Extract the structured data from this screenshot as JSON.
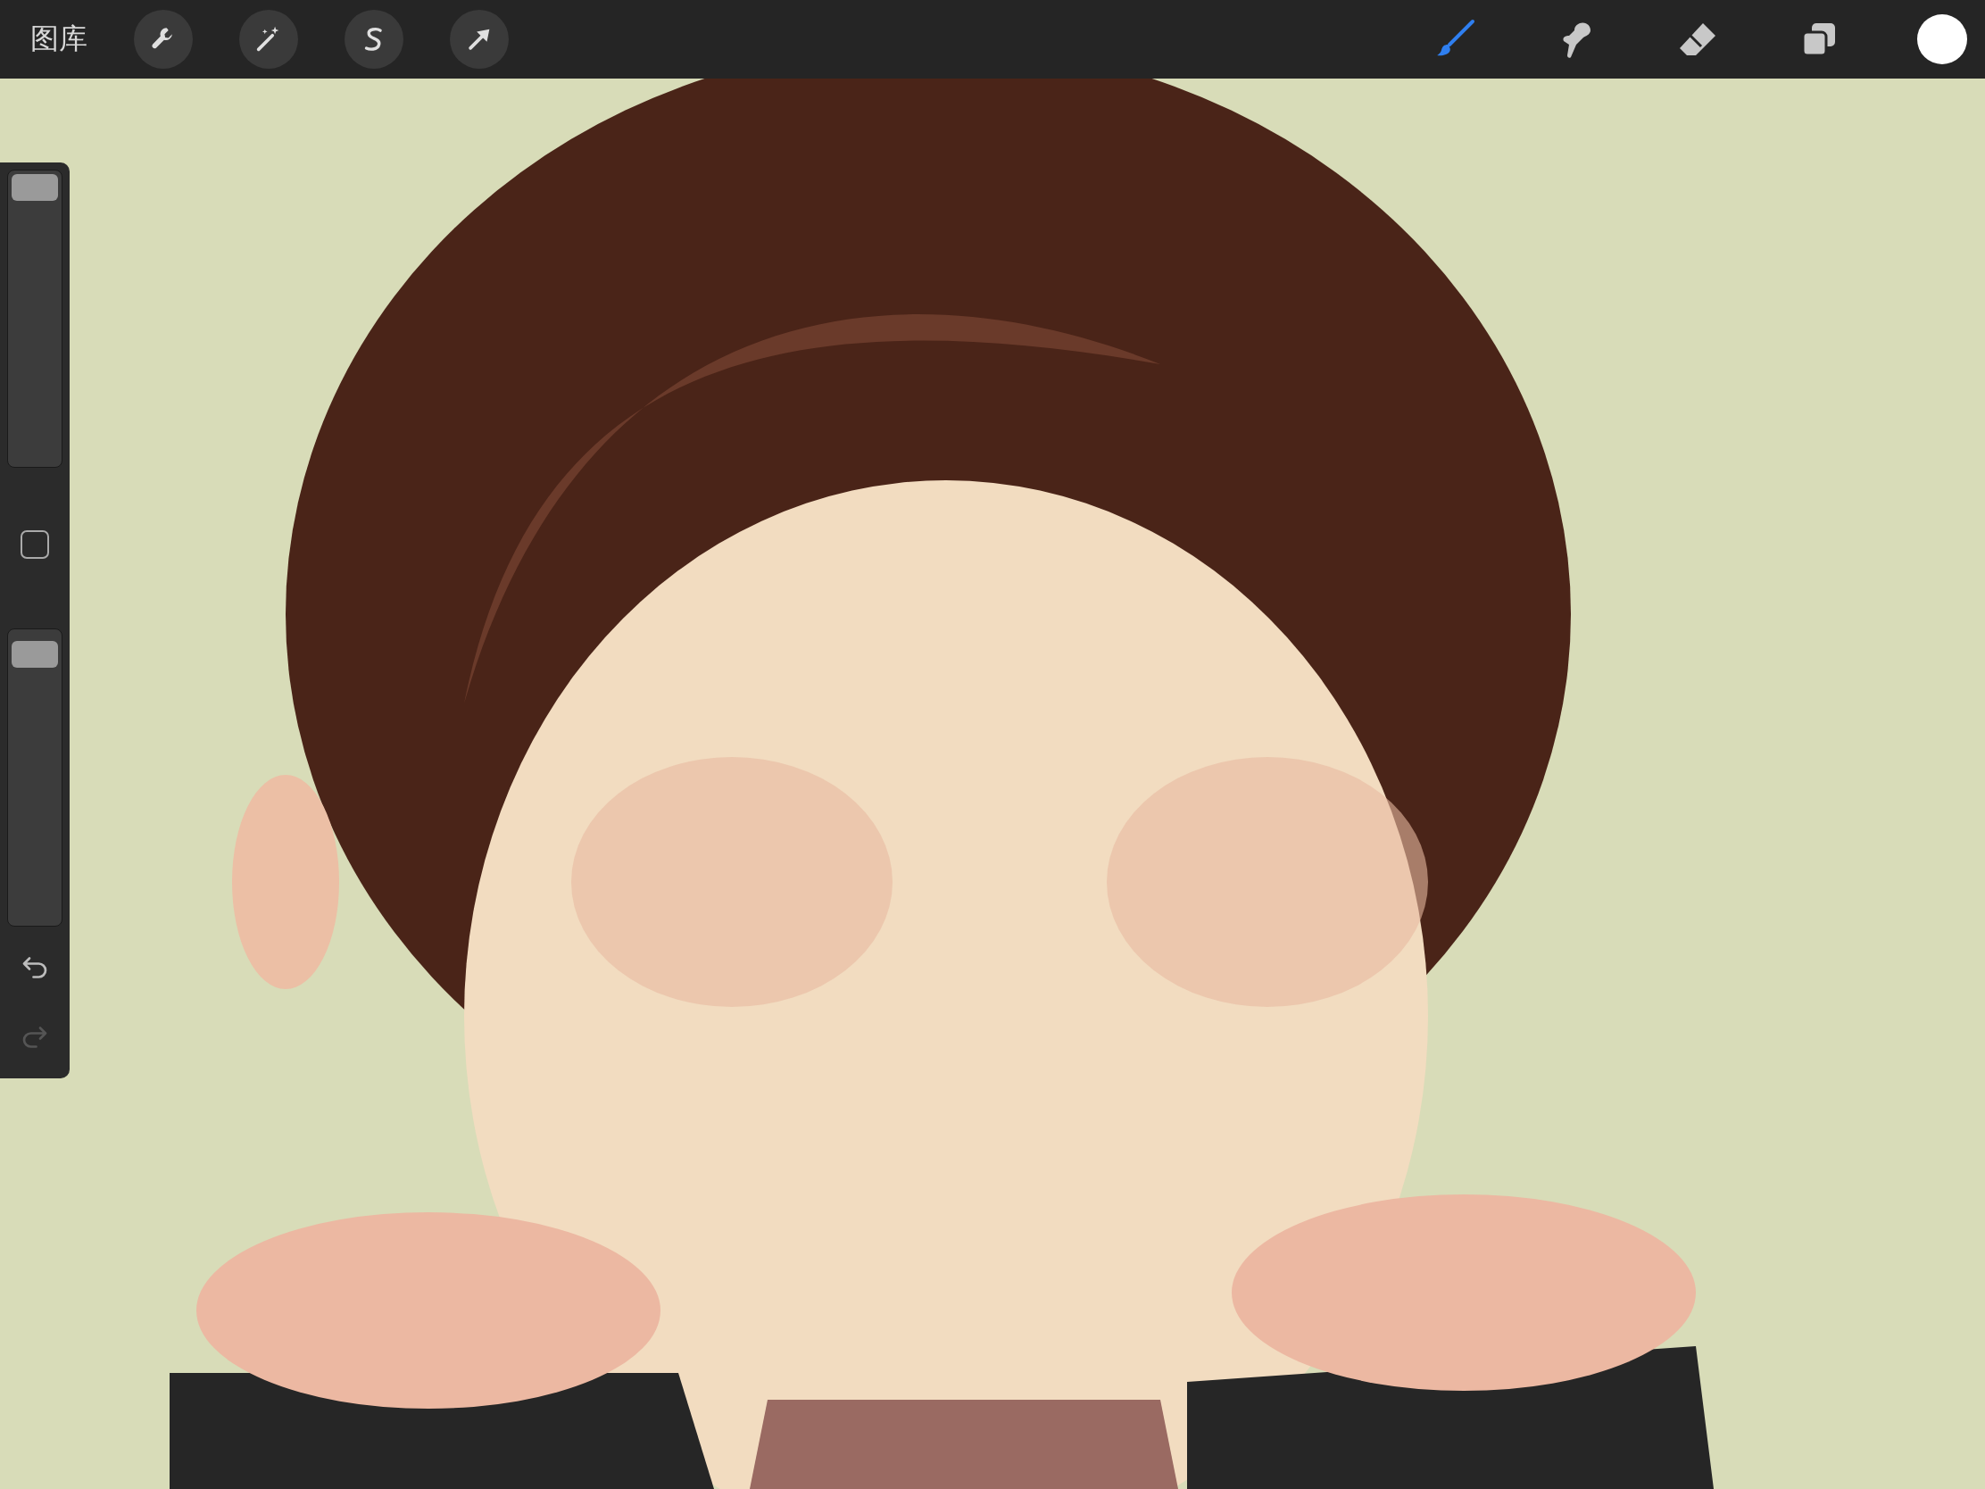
{
  "gallery_label": "图库",
  "paint_tools": [
    {
      "kind": "brush",
      "selected": true
    },
    {
      "kind": "smudge",
      "selected": false
    },
    {
      "kind": "eraser",
      "selected": false
    }
  ],
  "color_swatch": {
    "color": "#ffffff"
  },
  "sidebar": {
    "sliders": [
      {
        "level": 1
      },
      {
        "level": 0.97
      }
    ],
    "undo": {
      "disabled": false
    },
    "redo": {
      "disabled": true
    }
  }
}
